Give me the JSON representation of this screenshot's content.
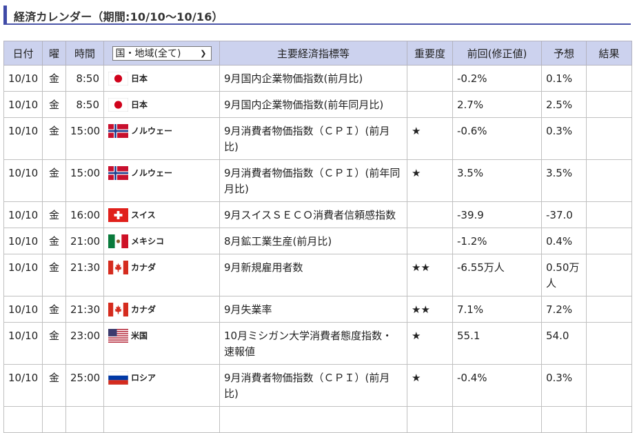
{
  "title": "経済カレンダー（期間:10/10～10/16）",
  "headers": {
    "date": "日付",
    "dow": "曜",
    "time": "時間",
    "country_filter": "国・地域(全て)",
    "indicator": "主要経済指標等",
    "importance": "重要度",
    "previous": "前回(修正値)",
    "forecast": "予想",
    "result": "結果"
  },
  "rows": [
    {
      "date": "10/10",
      "dow": "金",
      "time": "8:50",
      "flag": "jp",
      "country": "日本",
      "indicator": "9月国内企業物価指数(前月比)",
      "importance": "",
      "previous": "-0.2%",
      "forecast": "0.1%",
      "result": ""
    },
    {
      "date": "10/10",
      "dow": "金",
      "time": "8:50",
      "flag": "jp",
      "country": "日本",
      "indicator": "9月国内企業物価指数(前年同月比)",
      "importance": "",
      "previous": "2.7%",
      "forecast": "2.5%",
      "result": ""
    },
    {
      "date": "10/10",
      "dow": "金",
      "time": "15:00",
      "flag": "no",
      "country": "ノルウェー",
      "indicator": "9月消費者物価指数（ＣＰＩ）(前月比)",
      "importance": "★",
      "previous": "-0.6%",
      "forecast": "0.3%",
      "result": ""
    },
    {
      "date": "10/10",
      "dow": "金",
      "time": "15:00",
      "flag": "no",
      "country": "ノルウェー",
      "indicator": "9月消費者物価指数（ＣＰＩ）(前年同月比)",
      "importance": "★",
      "previous": "3.5%",
      "forecast": "3.5%",
      "result": ""
    },
    {
      "date": "10/10",
      "dow": "金",
      "time": "16:00",
      "flag": "ch",
      "country": "スイス",
      "indicator": "9月スイスＳＥＣＯ消費者信頼感指数",
      "importance": "",
      "previous": "-39.9",
      "forecast": "-37.0",
      "result": ""
    },
    {
      "date": "10/10",
      "dow": "金",
      "time": "21:00",
      "flag": "mx",
      "country": "メキシコ",
      "indicator": "8月鉱工業生産(前月比)",
      "importance": "",
      "previous": "-1.2%",
      "forecast": "0.4%",
      "result": ""
    },
    {
      "date": "10/10",
      "dow": "金",
      "time": "21:30",
      "flag": "ca",
      "country": "カナダ",
      "indicator": "9月新規雇用者数",
      "importance": "★★",
      "previous": "-6.55万人",
      "forecast": "0.50万人",
      "result": ""
    },
    {
      "date": "10/10",
      "dow": "金",
      "time": "21:30",
      "flag": "ca",
      "country": "カナダ",
      "indicator": "9月失業率",
      "importance": "★★",
      "previous": "7.1%",
      "forecast": "7.2%",
      "result": ""
    },
    {
      "date": "10/10",
      "dow": "金",
      "time": "23:00",
      "flag": "us",
      "country": "米国",
      "indicator": "10月ミシガン大学消費者態度指数・速報値",
      "importance": "★",
      "previous": "55.1",
      "forecast": "54.0",
      "result": ""
    },
    {
      "date": "10/10",
      "dow": "金",
      "time": "25:00",
      "flag": "ru",
      "country": "ロシア",
      "indicator": "9月消費者物価指数（ＣＰＩ）(前月比)",
      "importance": "★",
      "previous": "-0.4%",
      "forecast": "0.3%",
      "result": ""
    }
  ],
  "colors": {
    "accent": "#3f4aa7",
    "header_bg": "#ccd2ee",
    "grid": "#c0c0c0"
  }
}
